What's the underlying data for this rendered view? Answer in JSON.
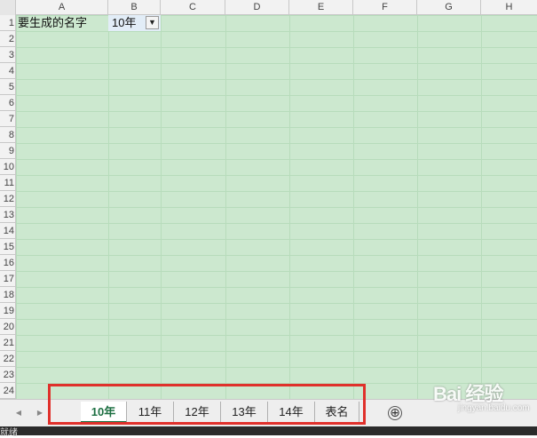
{
  "columns": [
    "A",
    "B",
    "C",
    "D",
    "E",
    "F",
    "G",
    "H"
  ],
  "rows": [
    "1",
    "2",
    "3",
    "4",
    "5",
    "6",
    "7",
    "8",
    "9",
    "10",
    "11",
    "12",
    "13",
    "14",
    "15",
    "16",
    "17",
    "18",
    "19",
    "20",
    "21",
    "22",
    "23",
    "24"
  ],
  "cells": {
    "A1": "要生成的名字",
    "B1": "10年"
  },
  "filter_icon": "filter-dropdown-icon",
  "sheet_tabs": [
    "10年",
    "11年",
    "12年",
    "13年",
    "14年",
    "表名"
  ],
  "active_tab": "10年",
  "add_sheet_symbol": "⊕",
  "nav_prev": "◀",
  "nav_next": "▶",
  "status": {
    "text": "就绪"
  },
  "watermark": {
    "brand": "Bai 经验",
    "url": "jingyan.baidu.com"
  },
  "colors": {
    "grid_bg": "#cce8cf",
    "active_tab": "#1d6f42",
    "highlight": "#e0302b"
  }
}
